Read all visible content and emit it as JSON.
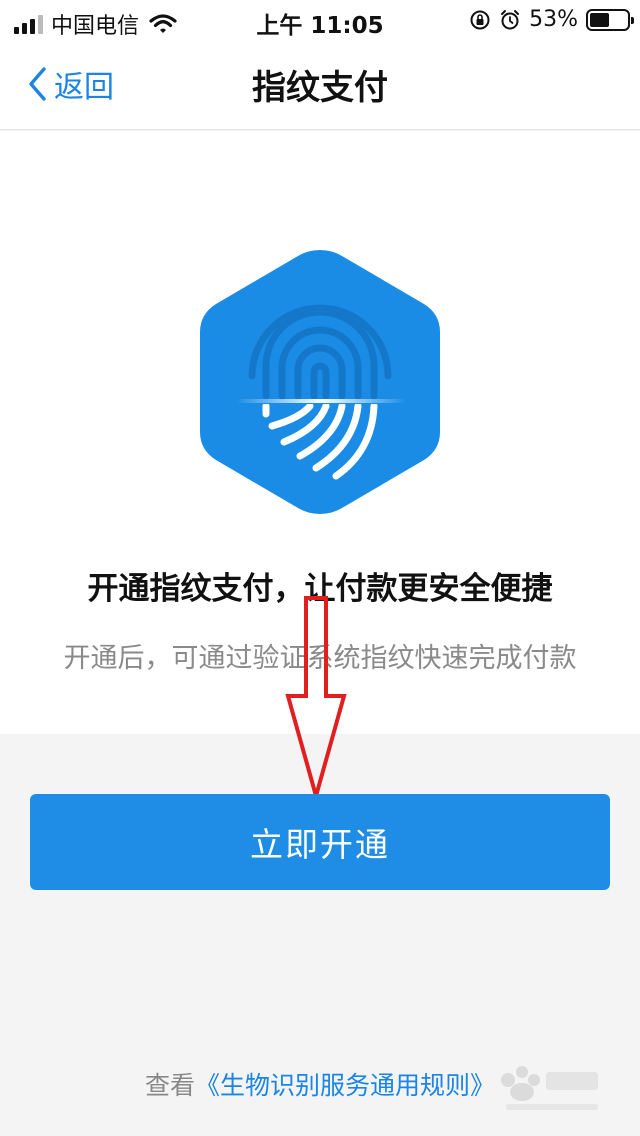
{
  "status_bar": {
    "carrier": "中国电信",
    "time": "上午 11:05",
    "battery_percent": "53%",
    "battery_level": 0.53
  },
  "nav": {
    "back_label": "返回",
    "title": "指纹支付"
  },
  "main": {
    "hero_icon": "fingerprint-hexagon-icon",
    "headline": "开通指纹支付，让付款更安全便捷",
    "subline": "开通后，可通过验证系统指纹快速完成付款"
  },
  "actions": {
    "primary_label": "立即开通"
  },
  "footer": {
    "prefix": "查看",
    "link_text": "《生物识别服务通用规则》"
  },
  "colors": {
    "accent": "#1f8de6",
    "link": "#1a85e4",
    "annotation_arrow": "#e02020"
  }
}
